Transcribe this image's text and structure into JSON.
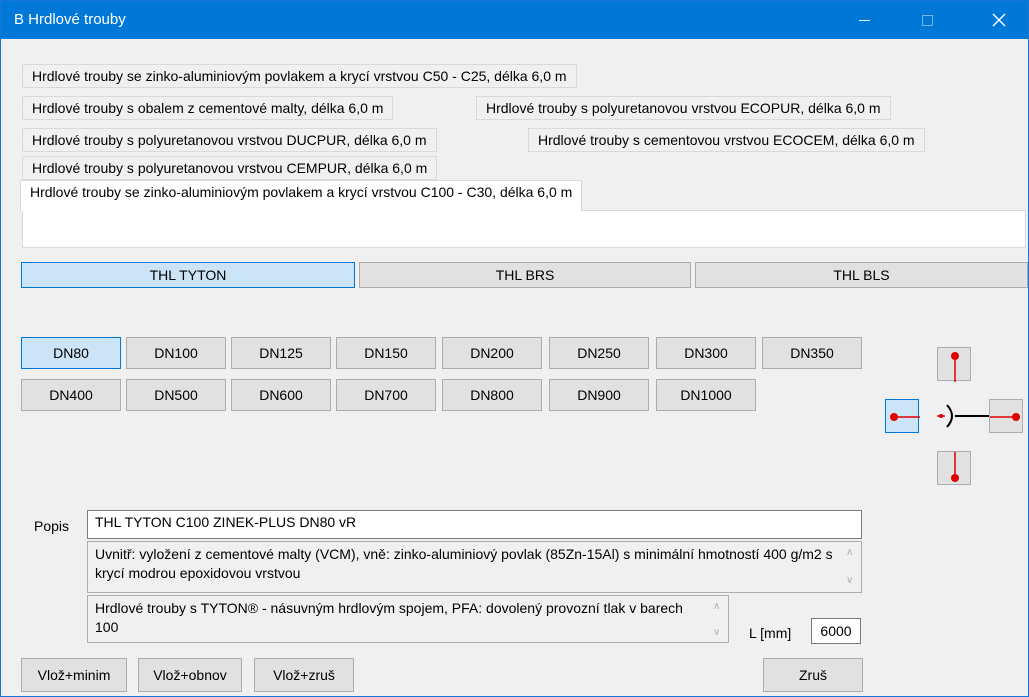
{
  "window": {
    "title": "B Hrdlové trouby"
  },
  "tabs": [
    "Hrdlové trouby se zinko-aluminiovým povlakem a krycí vrstvou C50 - C25, délka 6,0 m",
    "Hrdlové trouby s obalem z cementové malty, délka 6,0 m",
    "Hrdlové trouby s polyuretanovou vrstvou ECOPUR, délka 6,0 m",
    "Hrdlové trouby s polyuretanovou vrstvou DUCPUR, délka 6,0 m",
    "Hrdlové trouby s cementovou vrstvou ECOCEM, délka 6,0 m",
    "Hrdlové trouby s polyuretanovou vrstvou CEMPUR, délka 6,0 m",
    "Hrdlové trouby se zinko-aluminiovým povlakem a krycí vrstvou C100 - C30, délka 6,0 m"
  ],
  "joint_types": [
    "THL TYTON",
    "THL BRS",
    "THL BLS"
  ],
  "selected_joint": "THL TYTON",
  "dn_row1": [
    "DN80",
    "DN100",
    "DN125",
    "DN150",
    "DN200",
    "DN250",
    "DN300",
    "DN350"
  ],
  "dn_row2": [
    "DN400",
    "DN500",
    "DN600",
    "DN700",
    "DN800",
    "DN900",
    "DN1000"
  ],
  "selected_dn": "DN80",
  "details": {
    "popis_label": "Popis",
    "popis_value": "THL TYTON C100 ZINEK-PLUS DN80 vR",
    "desc1": "Uvnitř: vyložení z cementové malty (VCM), vně: zinko-aluminiový povlak (85Zn-15Al) s minimální hmotností 400 g/m2 s krycí modrou epoxidovou vrstvou",
    "desc2": "Hrdlové trouby s TYTON® - násuvným hrdlovým spojem, PFA: dovolený provozní tlak v barech 100",
    "length_label": "L [mm]",
    "length_value": "6000"
  },
  "actions": {
    "insert_min": "Vlož+minim",
    "insert_restore": "Vlož+obnov",
    "insert_cancel": "Vlož+zruš",
    "cancel": "Zruš"
  },
  "colors": {
    "accent": "#0078d7",
    "selected_fill": "#cce4f7",
    "connector_dot": "#e00000"
  }
}
